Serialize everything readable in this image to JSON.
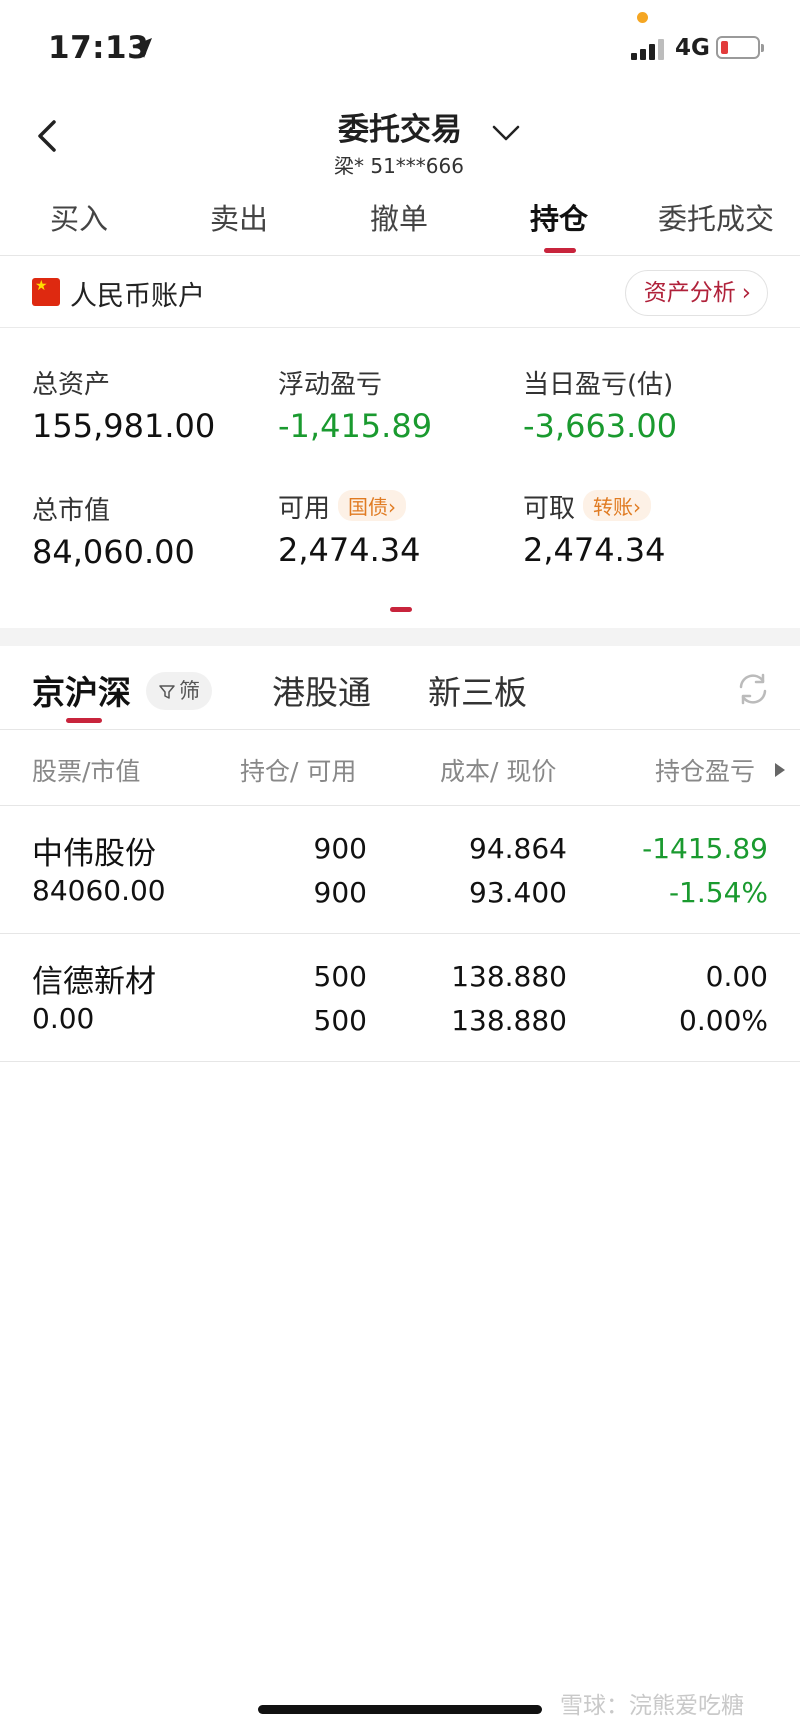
{
  "status_bar": {
    "time": "17:13",
    "network": "4G"
  },
  "header": {
    "title": "委托交易",
    "account": "梁* 51***666"
  },
  "tabs": [
    {
      "label": "买入"
    },
    {
      "label": "卖出"
    },
    {
      "label": "撤单"
    },
    {
      "label": "持仓",
      "active": true
    },
    {
      "label": "委托成交"
    }
  ],
  "account": {
    "label": "人民币账户",
    "analysis_button": "资产分析"
  },
  "summary": {
    "total_assets": {
      "label": "总资产",
      "value": "155,981.00"
    },
    "floating_pnl": {
      "label": "浮动盈亏",
      "value": "-1,415.89"
    },
    "daily_pnl": {
      "label": "当日盈亏(估)",
      "value": "-3,663.00"
    },
    "market_value": {
      "label": "总市值",
      "value": "84,060.00"
    },
    "available": {
      "label": "可用",
      "tag": "国债",
      "value": "2,474.34"
    },
    "withdrawable": {
      "label": "可取",
      "tag": "转账",
      "value": "2,474.34"
    }
  },
  "markets": {
    "tabs": [
      "京沪深",
      "港股通",
      "新三板"
    ],
    "filter_label": "筛"
  },
  "table": {
    "headers": [
      "股票/市值",
      "持仓/ 可用",
      "成本/ 现价",
      "持仓盈亏"
    ],
    "rows": [
      {
        "name": "中伟股份",
        "market_value": "84060.00",
        "position": "900",
        "available": "900",
        "cost": "94.864",
        "price": "93.400",
        "pnl": "-1415.89",
        "pnl_pct": "-1.54%",
        "negative": true
      },
      {
        "name": "信德新材",
        "market_value": "0.00",
        "position": "500",
        "available": "500",
        "cost": "138.880",
        "price": "138.880",
        "pnl": "0.00",
        "pnl_pct": "0.00%",
        "negative": false
      }
    ]
  },
  "watermark": "雪球：浣熊爱吃糖",
  "colors": {
    "accent": "#c8243c",
    "loss": "#1a9a2f",
    "tag_orange": "#e07b22"
  }
}
